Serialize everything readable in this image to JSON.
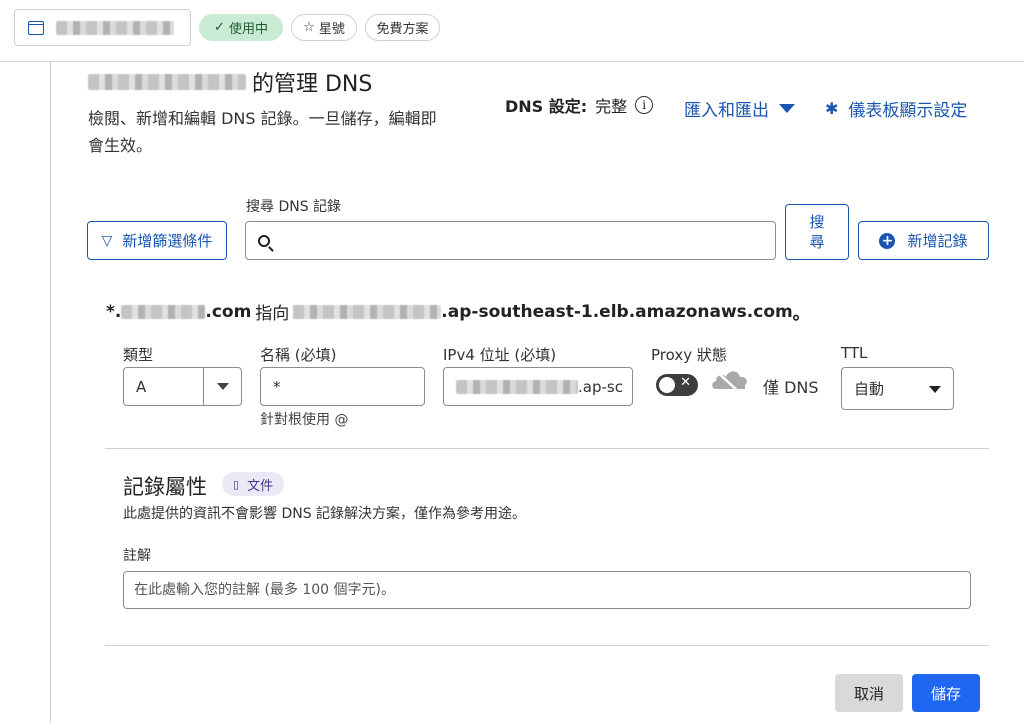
{
  "topbar": {
    "domain_chip_icon": "browser-window-icon",
    "status_pill": {
      "icon": "checkmark-icon",
      "label": "使用中"
    },
    "star_pill": {
      "icon": "star-outline-icon",
      "label": "星號"
    },
    "plan_pill": {
      "label": "免費方案"
    }
  },
  "header": {
    "title_suffix": "的管理 DNS",
    "description": "檢閱、新增和編輯 DNS 記錄。一旦儲存，編輯即會生效。",
    "dns_setup_label": "DNS 設定:",
    "dns_setup_value": "完整",
    "import_export_label": "匯入和匯出",
    "dashboard_settings_label": "儀表板顯示設定"
  },
  "search": {
    "label": "搜尋 DNS 記錄",
    "value": "",
    "placeholder": "",
    "filter_button": "新增篩選條件",
    "search_button": "搜尋",
    "add_record_button": "新增記錄"
  },
  "record": {
    "summary_prefix": "*.",
    "summary_tld": ".com",
    "summary_points_to": "指向",
    "summary_target_suffix": ".ap-southeast-1.elb.amazonaws.com",
    "summary_end": "。",
    "type_label": "類型",
    "type_value": "A",
    "name_label": "名稱 (必填)",
    "name_value": "*",
    "name_hint": "針對根使用 @",
    "ipv4_label": "IPv4 位址 (必填)",
    "ipv4_value_suffix": ".ap-sc",
    "proxy_label": "Proxy 狀態",
    "proxy_state": "僅 DNS",
    "proxy_enabled": false,
    "ttl_label": "TTL",
    "ttl_value": "自動"
  },
  "attributes": {
    "title": "記錄屬性",
    "doc_badge": "文件",
    "description": "此處提供的資訊不會影響 DNS 記錄解決方案，僅作為參考用途。",
    "comment_label": "註解",
    "comment_value": "",
    "comment_placeholder": "在此處輸入您的註解 (最多 100 個字元)。"
  },
  "actions": {
    "cancel": "取消",
    "save": "儲存"
  },
  "colors": {
    "accent": "#1a56b0",
    "primary_button": "#1f66f0",
    "active_pill_bg": "#c9ebd3",
    "doc_badge_bg": "#ece9f7"
  }
}
